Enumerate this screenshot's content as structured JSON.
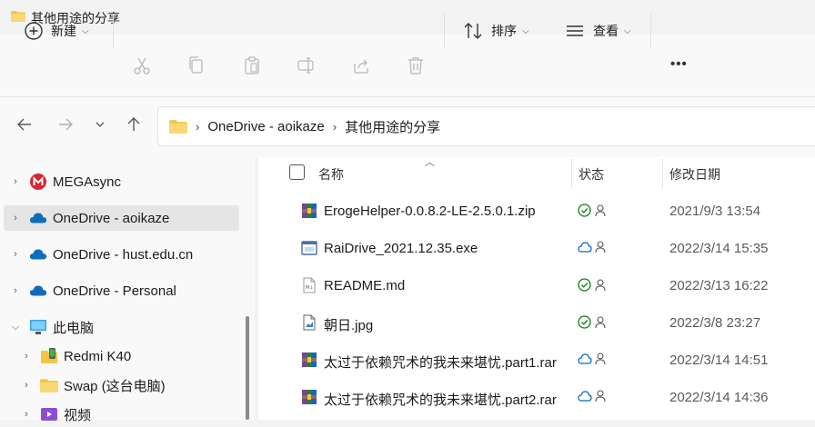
{
  "window": {
    "title": "其他用途的分享",
    "folder_icon": "folder-icon"
  },
  "toolbar": {
    "new_label": "新建",
    "sort_label": "排序",
    "view_label": "查看",
    "more_label": "•••"
  },
  "address": {
    "segments": [
      "OneDrive - aoikaze",
      "其他用途的分享"
    ]
  },
  "nav": {
    "items": [
      {
        "label": "MEGAsync",
        "icon": "mega-icon"
      },
      {
        "label": "OneDrive - aoikaze",
        "icon": "cloud-icon",
        "selected": true
      },
      {
        "label": "OneDrive - hust.edu.cn",
        "icon": "cloud-icon"
      },
      {
        "label": "OneDrive - Personal",
        "icon": "cloud-icon"
      },
      {
        "label": "此电脑",
        "icon": "computer-icon"
      },
      {
        "label": "Redmi K40",
        "icon": "phone-icon"
      },
      {
        "label": "Swap (这台电脑)",
        "icon": "folder-icon"
      },
      {
        "label": "视频",
        "icon": "video-icon"
      }
    ]
  },
  "columns": {
    "name": "名称",
    "status": "状态",
    "modified": "修改日期"
  },
  "files": [
    {
      "name": "ErogeHelper-0.0.8.2-LE-2.5.0.1.zip",
      "date": "2021/9/3 13:54",
      "type": "archive",
      "status": "synced"
    },
    {
      "name": "RaiDrive_2021.12.35.exe",
      "date": "2022/3/14 15:35",
      "type": "exe",
      "status": "cloud"
    },
    {
      "name": "README.md",
      "date": "2022/3/13 16:22",
      "type": "md",
      "status": "synced"
    },
    {
      "name": "朝日.jpg",
      "date": "2022/3/8 23:27",
      "type": "image",
      "status": "synced"
    },
    {
      "name": "太过于依赖咒术的我未来堪忧.part1.rar",
      "date": "2022/3/14 14:51",
      "type": "archive",
      "status": "cloud"
    },
    {
      "name": "太过于依赖咒术的我未来堪忧.part2.rar",
      "date": "2022/3/14 14:36",
      "type": "archive",
      "status": "cloud"
    }
  ],
  "colors": {
    "accent": "#0067c0",
    "synced": "#107c10",
    "cloud": "#0067c0",
    "folder": "#f4c542"
  }
}
